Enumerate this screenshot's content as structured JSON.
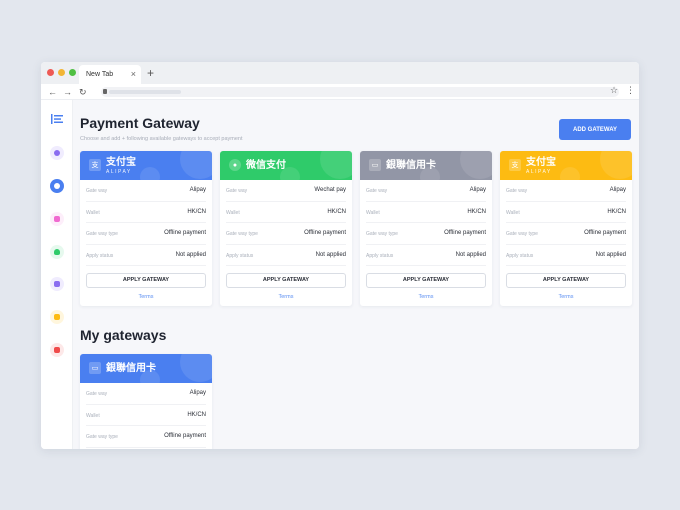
{
  "browser": {
    "tab_label": "New Tab",
    "tab_close": "×",
    "new_tab": "+"
  },
  "page": {
    "title": "Payment Gateway",
    "subtitle": "Choose and add + following available gateways to accept payment",
    "add_button": "ADD GATEWAY",
    "my_gateways_title": "My gateways"
  },
  "colors": {
    "accent": "#4a7ff0",
    "alipay": "#4a7ff0",
    "wechat": "#2fcb6a",
    "unionpay": "#9296a6",
    "yellow": "#fdbb12"
  },
  "sidebar": {
    "items": [
      {
        "icon": "menu-icon",
        "color": "#4a7ff0"
      },
      {
        "icon": "apps-icon",
        "color": "#8a6cf0"
      },
      {
        "icon": "chart-icon",
        "color": "#4a7ff0"
      },
      {
        "icon": "folder-icon",
        "color": "#f06ad0"
      },
      {
        "icon": "user-icon",
        "color": "#2fcb6a"
      },
      {
        "icon": "inbox-icon",
        "color": "#8a6cf0"
      },
      {
        "icon": "lock-icon",
        "color": "#fdbb12"
      },
      {
        "icon": "gift-icon",
        "color": "#ef4b4b"
      }
    ]
  },
  "labels": {
    "gateway": "Gate way",
    "wallet": "Wallet",
    "gateway_type": "Gate way type",
    "apply_status": "Apply status",
    "apply_button": "APPLY GATEWAY",
    "terms": "Terms"
  },
  "gateways": [
    {
      "brand": "支付宝",
      "brand_sub": "ALIPAY",
      "logo": "alipay-icon",
      "gateway": "Alipay",
      "wallet": "HK/CN",
      "type": "Offline payment",
      "status": "Not applied"
    },
    {
      "brand": "微信支付",
      "brand_sub": "",
      "logo": "wechat-icon",
      "gateway": "Wechat pay",
      "wallet": "HK/CN",
      "type": "Offline payment",
      "status": "Not applied"
    },
    {
      "brand": "銀聯信用卡",
      "brand_sub": "",
      "logo": "unionpay-icon",
      "gateway": "Alipay",
      "wallet": "HK/CN",
      "type": "Offline payment",
      "status": "Not applied"
    },
    {
      "brand": "支付宝",
      "brand_sub": "ALIPAY",
      "logo": "alipay-icon",
      "gateway": "Alipay",
      "wallet": "HK/CN",
      "type": "Offline payment",
      "status": "Not applied"
    }
  ],
  "my_gateways": [
    {
      "brand": "銀聯信用卡",
      "logo": "unionpay-icon",
      "gateway": "Alipay",
      "wallet": "HK/CN",
      "type": "Offline payment"
    }
  ]
}
